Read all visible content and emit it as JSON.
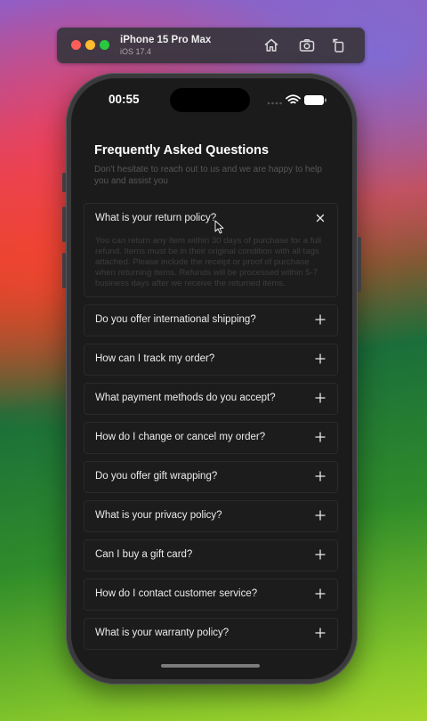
{
  "simulator": {
    "device_name": "iPhone 15 Pro Max",
    "os_version": "iOS 17.4",
    "icons": [
      "home-icon",
      "screenshot-icon",
      "rotate-icon"
    ]
  },
  "status_bar": {
    "time": "00:55",
    "icons": [
      "signal-icon",
      "wifi-icon",
      "battery-icon"
    ]
  },
  "faq": {
    "title": "Frequently Asked Questions",
    "subtitle": "Don't hesitate to reach out to us and we are happy to help you and assist you",
    "items": [
      {
        "question": "What is your return policy?",
        "expanded": true,
        "toggle_icon": "close-icon",
        "answer": "You can return any item within 30 days of purchase for a full refund. Items must be in their original condition with all tags attached. Please include the receipt or proof of purchase when returning items. Refunds will be processed within 5-7 business days after we receive the returned items."
      },
      {
        "question": "Do you offer international shipping?",
        "expanded": false,
        "toggle_icon": "plus-icon"
      },
      {
        "question": "How can I track my order?",
        "expanded": false,
        "toggle_icon": "plus-icon"
      },
      {
        "question": "What payment methods do you accept?",
        "expanded": false,
        "toggle_icon": "plus-icon"
      },
      {
        "question": "How do I change or cancel my order?",
        "expanded": false,
        "toggle_icon": "plus-icon"
      },
      {
        "question": "Do you offer gift wrapping?",
        "expanded": false,
        "toggle_icon": "plus-icon"
      },
      {
        "question": "What is your privacy policy?",
        "expanded": false,
        "toggle_icon": "plus-icon"
      },
      {
        "question": "Can I buy a gift card?",
        "expanded": false,
        "toggle_icon": "plus-icon"
      },
      {
        "question": "How do I contact customer service?",
        "expanded": false,
        "toggle_icon": "plus-icon"
      },
      {
        "question": "What is your warranty policy?",
        "expanded": false,
        "toggle_icon": "plus-icon"
      }
    ]
  },
  "colors": {
    "screen_background": "#1b1b1b",
    "item_border": "#2a2a2a",
    "answer_text": "#3d3d3d"
  }
}
